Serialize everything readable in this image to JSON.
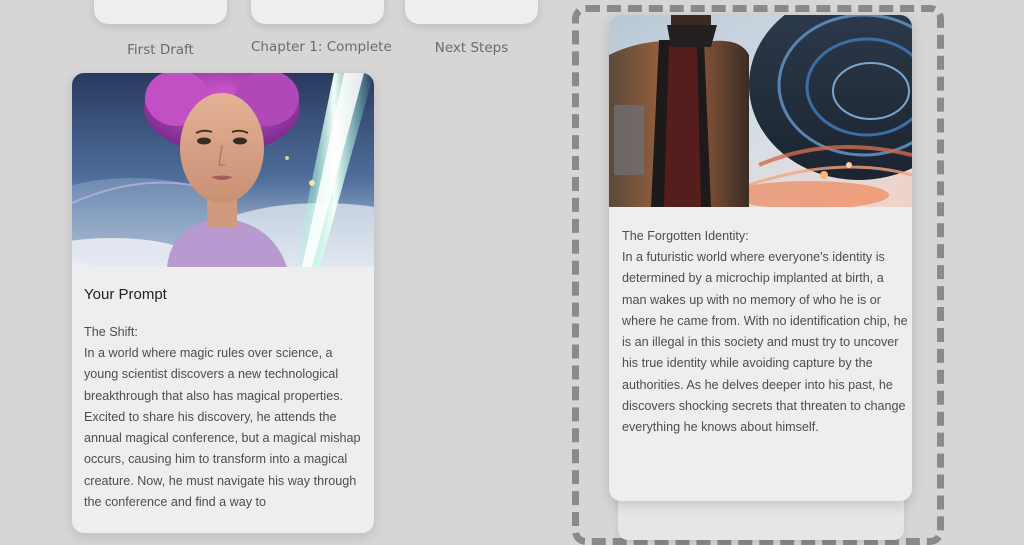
{
  "steps": [
    {
      "label": "First Draft"
    },
    {
      "label": "Chapter 1: Complete"
    },
    {
      "label": "Next Steps"
    }
  ],
  "prompt_card": {
    "title": "Your Prompt",
    "story_title": "The Shift:",
    "story_body": "In a world where magic rules over science, a young scientist discovers a new technological breakthrough that also has magical properties. Excited to share his discovery, he attends the annual magical conference, but a magical mishap occurs, causing him to transform into a magical creature. Now, he must navigate his way through the conference and find a way to",
    "image_subject": "portrait-woman-purple-hair-light-beam"
  },
  "result_card": {
    "story_title": "The Forgotten Identity:",
    "story_body": "In a futuristic world where everyone's identity is determined by a microchip implanted at birth, a man wakes up with no memory of who he is or where he came from. With no identification chip, he is an illegal in this society and must try to uncover his true identity while avoiding capture by the authorities. As he delves deeper into his past, he discovers shocking secrets that threaten to change everything he knows about himself.",
    "image_subject": "futuristic-man-city"
  },
  "colors": {
    "background": "#d6d6d6",
    "card": "#eeeeee",
    "dashed_border": "#8a8a8a"
  }
}
